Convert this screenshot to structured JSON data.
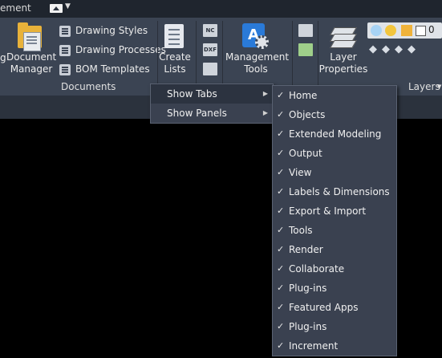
{
  "topbar": {
    "title": "ement"
  },
  "ribbon": {
    "document_manager": {
      "left_cut": "g",
      "label_line1": "Document",
      "label_line2": "Manager"
    },
    "document_tools": [
      {
        "label": "Drawing Styles",
        "icon": "drawing-styles-icon"
      },
      {
        "label": "Drawing Processes",
        "icon": "drawing-processes-icon"
      },
      {
        "label": "BOM Templates",
        "icon": "bom-templates-icon"
      }
    ],
    "create_lists": {
      "label_line1": "Create",
      "label_line2": "Lists"
    },
    "side_icons": [
      "NC",
      "DXF"
    ],
    "management_tools": {
      "label_line1": "Management",
      "label_line2": "Tools"
    },
    "layer_properties": {
      "label_line1": "Layer",
      "label_line2": "Properties",
      "layer_number": "0"
    },
    "panels": {
      "documents": "Documents",
      "layers": "Layers"
    }
  },
  "context_menu": {
    "items": [
      {
        "label": "Show Tabs",
        "active": true
      },
      {
        "label": "Show Panels",
        "active": false
      }
    ]
  },
  "tabs_submenu": {
    "items": [
      {
        "label": "Home",
        "checked": true
      },
      {
        "label": "Objects",
        "checked": true
      },
      {
        "label": "Extended Modeling",
        "checked": true
      },
      {
        "label": "Output",
        "checked": true
      },
      {
        "label": "View",
        "checked": true
      },
      {
        "label": "Labels & Dimensions",
        "checked": true
      },
      {
        "label": "Export & Import",
        "checked": true
      },
      {
        "label": "Tools",
        "checked": true
      },
      {
        "label": "Render",
        "checked": true
      },
      {
        "label": "Collaborate",
        "checked": true
      },
      {
        "label": "Plug-ins",
        "checked": true
      },
      {
        "label": "Featured Apps",
        "checked": true
      },
      {
        "label": "Plug-ins",
        "checked": true
      },
      {
        "label": "Increment",
        "checked": true
      }
    ]
  },
  "glyphs": {
    "check": "✓",
    "arrow": "▶",
    "dropdown": "▼"
  }
}
